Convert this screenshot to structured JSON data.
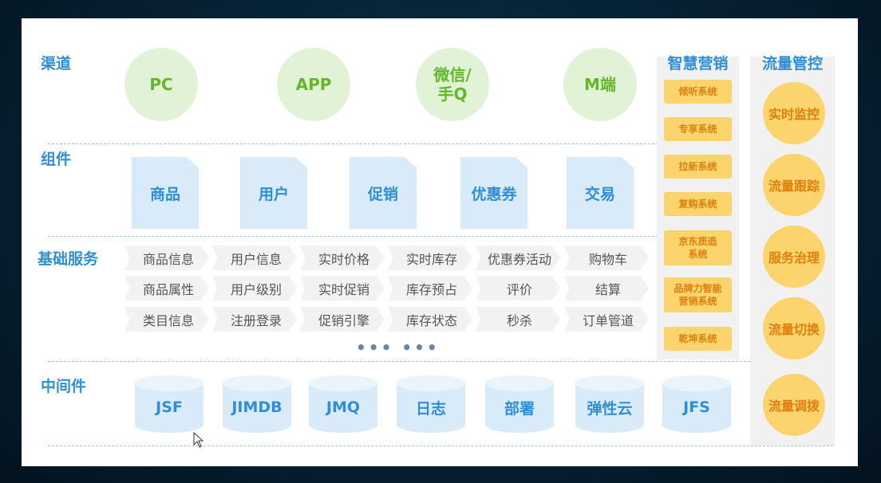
{
  "rows": {
    "channel": "渠道",
    "component": "组件",
    "base_service": "基础服务",
    "middleware": "中间件"
  },
  "channels": [
    "PC",
    "APP",
    "微信/\n手Q",
    "M端"
  ],
  "components": [
    "商品",
    "用户",
    "促销",
    "优惠券",
    "交易"
  ],
  "services": [
    [
      "商品信息",
      "用户信息",
      "实时价格",
      "实时库存",
      "优惠券活动",
      "购物车"
    ],
    [
      "商品属性",
      "用户级别",
      "实时促销",
      "库存预占",
      "评价",
      "结算"
    ],
    [
      "类目信息",
      "注册登录",
      "促销引擎",
      "库存状态",
      "秒杀",
      "订单管道"
    ]
  ],
  "ellipsis": "••• •••",
  "middleware": [
    "JSF",
    "JIMDB",
    "JMQ",
    "日志",
    "部署",
    "弹性云",
    "JFS"
  ],
  "smart_marketing": {
    "title": "智慧营销",
    "items": [
      "倾听系统",
      "专享系统",
      "拉新系统",
      "复购系统",
      "京东质造\n系统",
      "品牌力智能\n营销系统",
      "乾坤系统"
    ]
  },
  "traffic_control": {
    "title": "流量管控",
    "items": [
      "实时监控",
      "流量跟踪",
      "服务治理",
      "流量切换",
      "流量调拨"
    ]
  },
  "colors": {
    "label_blue": "#2f8fd6",
    "channel_green": "#64b72b",
    "channel_bg": "#e1f2d6",
    "component_bg": "#d9ebf8",
    "marketing_yellow": "#fcd46d",
    "marketing_text": "#e07f0c"
  }
}
